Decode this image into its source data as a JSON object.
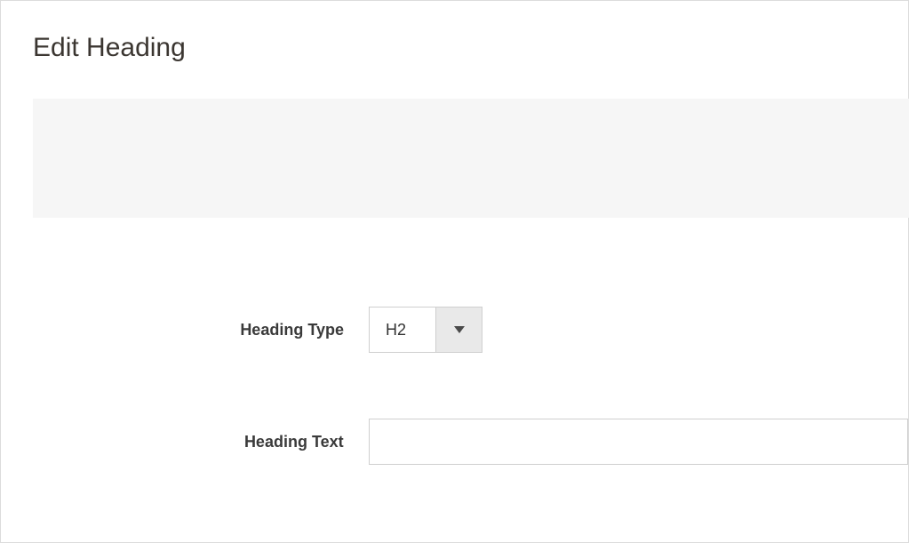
{
  "panel": {
    "title": "Edit Heading"
  },
  "form": {
    "heading_type": {
      "label": "Heading Type",
      "value": "H2"
    },
    "heading_text": {
      "label": "Heading Text",
      "value": ""
    }
  }
}
